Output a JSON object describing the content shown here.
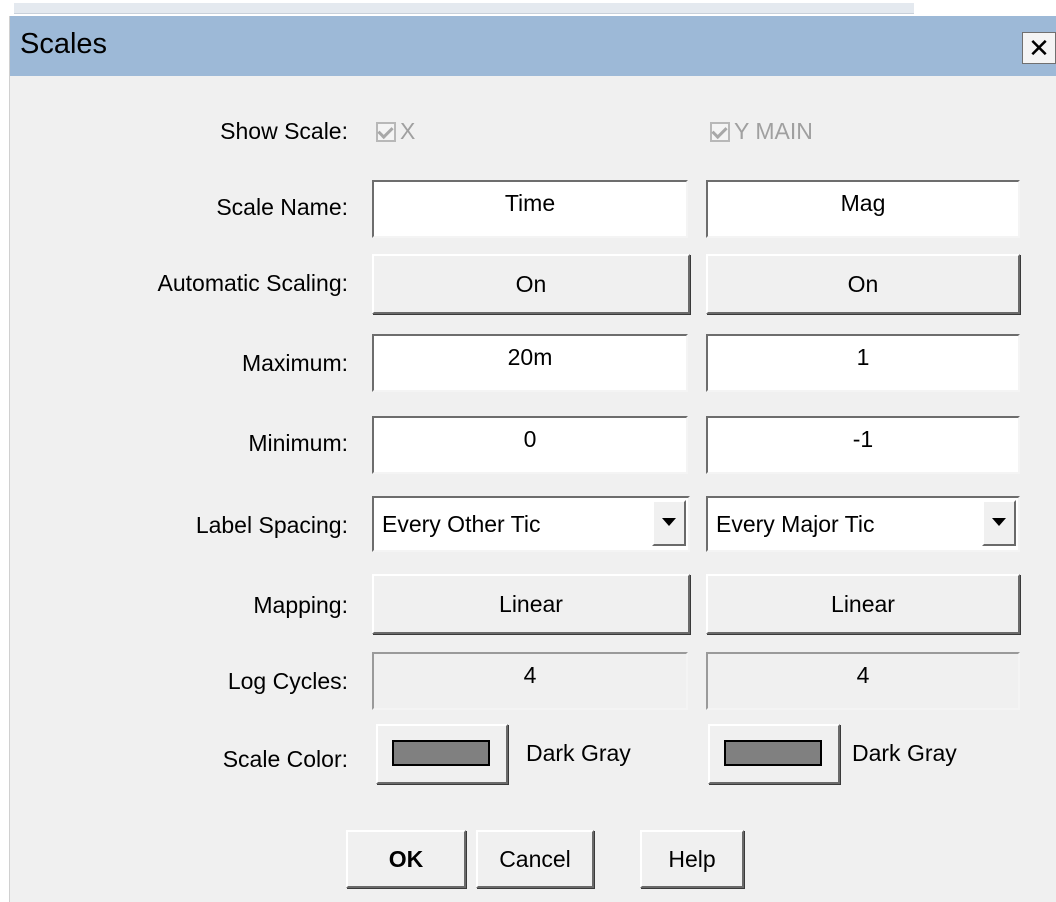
{
  "dialog": {
    "title": "Scales",
    "close_glyph": "✕"
  },
  "labels": {
    "show_scale": "Show Scale:",
    "scale_name": "Scale Name:",
    "automatic_scaling": "Automatic Scaling:",
    "maximum": "Maximum:",
    "minimum": "Minimum:",
    "label_spacing": "Label Spacing:",
    "mapping": "Mapping:",
    "log_cycles": "Log Cycles:",
    "scale_color": "Scale Color:"
  },
  "x": {
    "show_label": "X",
    "show_checked": true,
    "scale_name": "Time",
    "automatic_scaling": "On",
    "maximum": "20m",
    "minimum": "0",
    "label_spacing": "Every Other Tic",
    "mapping": "Linear",
    "log_cycles": "4",
    "color_name": "Dark Gray",
    "color_hex": "#808080"
  },
  "y": {
    "show_label": "Y MAIN",
    "show_checked": true,
    "scale_name": "Mag",
    "automatic_scaling": "On",
    "maximum": "1",
    "minimum": "-1",
    "label_spacing": "Every Major Tic",
    "mapping": "Linear",
    "log_cycles": "4",
    "color_name": "Dark Gray",
    "color_hex": "#808080"
  },
  "buttons": {
    "ok": "OK",
    "cancel": "Cancel",
    "help": "Help"
  }
}
